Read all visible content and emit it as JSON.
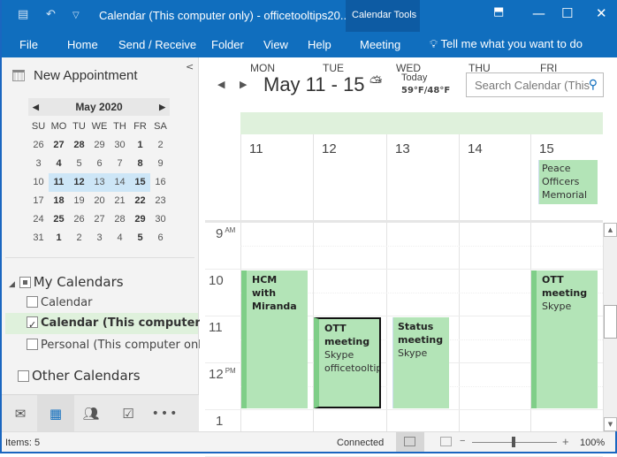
{
  "titlebar": {
    "title": "Calendar (This computer only) - officetooltips20...",
    "context_tab_group": "Calendar Tools",
    "icons": [
      "send-receive-icon",
      "undo-icon",
      "customize-qat-icon"
    ],
    "window_buttons": [
      "ribbon-display-options",
      "minimize",
      "maximize",
      "close"
    ]
  },
  "ribbon": {
    "tabs": [
      {
        "label": "File"
      },
      {
        "label": "Home"
      },
      {
        "label": "Send / Receive"
      },
      {
        "label": "Folder"
      },
      {
        "label": "View"
      },
      {
        "label": "Help"
      },
      {
        "label": "Meeting",
        "active": true
      }
    ],
    "tell_me": "Tell me what you want to do"
  },
  "leftpane": {
    "new_appointment": "New Appointment",
    "mini_calendar": {
      "month_label": "May 2020",
      "weekdays": [
        "SU",
        "MO",
        "TU",
        "WE",
        "TH",
        "FR",
        "SA"
      ],
      "weeks": [
        [
          {
            "d": "26"
          },
          {
            "d": "27",
            "b": 1
          },
          {
            "d": "28",
            "b": 1
          },
          {
            "d": "29"
          },
          {
            "d": "30"
          },
          {
            "d": "1",
            "b": 1
          },
          {
            "d": "2"
          }
        ],
        [
          {
            "d": "3"
          },
          {
            "d": "4",
            "b": 1
          },
          {
            "d": "5"
          },
          {
            "d": "6"
          },
          {
            "d": "7"
          },
          {
            "d": "8",
            "b": 1
          },
          {
            "d": "9"
          }
        ],
        [
          {
            "d": "10"
          },
          {
            "d": "11",
            "b": 1,
            "s": 1
          },
          {
            "d": "12",
            "b": 1,
            "s": 1
          },
          {
            "d": "13",
            "s": 1
          },
          {
            "d": "14",
            "s": 1
          },
          {
            "d": "15",
            "b": 1,
            "s": 1
          },
          {
            "d": "16"
          }
        ],
        [
          {
            "d": "17"
          },
          {
            "d": "18",
            "b": 1
          },
          {
            "d": "19"
          },
          {
            "d": "20"
          },
          {
            "d": "21"
          },
          {
            "d": "22",
            "b": 1
          },
          {
            "d": "23"
          }
        ],
        [
          {
            "d": "24"
          },
          {
            "d": "25",
            "b": 1
          },
          {
            "d": "26"
          },
          {
            "d": "27"
          },
          {
            "d": "28"
          },
          {
            "d": "29",
            "b": 1
          },
          {
            "d": "30"
          }
        ],
        [
          {
            "d": "31"
          },
          {
            "d": "1",
            "b": 1
          },
          {
            "d": "2"
          },
          {
            "d": "3"
          },
          {
            "d": "4"
          },
          {
            "d": "5",
            "b": 1
          },
          {
            "d": "6"
          }
        ]
      ]
    },
    "my_calendars": {
      "label": "My Calendars",
      "items": [
        {
          "label": "Calendar",
          "checked": false
        },
        {
          "label": "Calendar (This computer only)",
          "checked": true
        },
        {
          "label": "Personal (This computer only)",
          "checked": false
        }
      ]
    },
    "other_calendars": "Other Calendars",
    "nav": [
      "mail",
      "calendar",
      "people",
      "tasks",
      "more"
    ]
  },
  "main": {
    "date_range": "May 11 - 15",
    "weather": {
      "label": "Today",
      "temps": "59°F/48°F",
      "icon": "partly-cloudy"
    },
    "search_placeholder": "Search Calendar (This",
    "days": [
      {
        "name": "MON",
        "num": "11"
      },
      {
        "name": "TUE",
        "num": "12"
      },
      {
        "name": "WED",
        "num": "13"
      },
      {
        "name": "THU",
        "num": "14"
      },
      {
        "name": "FRI",
        "num": "15"
      }
    ],
    "all_day_events": [
      {
        "day": 4,
        "title": "Peace Officers Memorial D..."
      }
    ],
    "hours": [
      {
        "h": "9",
        "suffix": "AM"
      },
      {
        "h": "10",
        "suffix": ""
      },
      {
        "h": "11",
        "suffix": ""
      },
      {
        "h": "12",
        "suffix": "PM"
      },
      {
        "h": "1",
        "suffix": ""
      }
    ],
    "events": [
      {
        "day": 0,
        "start": 10,
        "end": 13,
        "title": "HCM with Miranda",
        "location": ""
      },
      {
        "day": 1,
        "start": 11,
        "end": 13,
        "title": "OTT meeting",
        "location": "Skype officetooltips",
        "selected": true
      },
      {
        "day": 2,
        "start": 11,
        "end": 13,
        "title": "Status meeting",
        "location": "Skype",
        "tentative": true
      },
      {
        "day": 4,
        "start": 10,
        "end": 13,
        "title": "OTT meeting",
        "location": "Skype"
      }
    ]
  },
  "status": {
    "items": "Items: 5",
    "connection": "Connected",
    "zoom": "100%",
    "zoom_level": 1.0
  }
}
